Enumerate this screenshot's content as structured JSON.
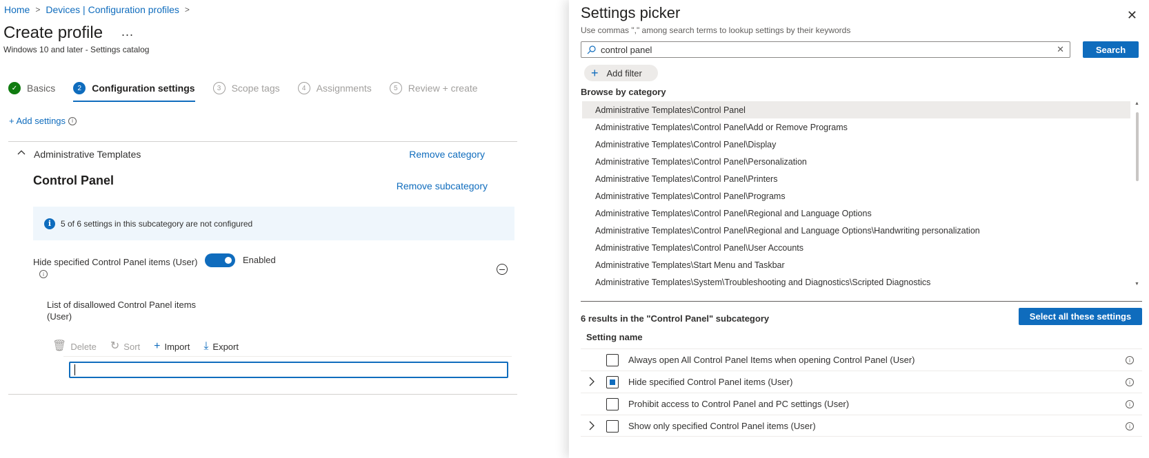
{
  "breadcrumb": {
    "home": "Home",
    "profiles": "Devices | Configuration profiles",
    "sep": ">"
  },
  "page": {
    "title": "Create profile",
    "more": "...",
    "subtitle": "Windows 10 and later - Settings catalog"
  },
  "steps": [
    {
      "num": "✓",
      "label": "Basics"
    },
    {
      "num": "2",
      "label": "Configuration settings"
    },
    {
      "num": "3",
      "label": "Scope tags"
    },
    {
      "num": "4",
      "label": "Assignments"
    },
    {
      "num": "5",
      "label": "Review + create"
    }
  ],
  "add_settings": "+ Add settings",
  "category": {
    "name": "Administrative Templates",
    "remove_category": "Remove category",
    "subcategory": "Control Panel",
    "remove_subcategory": "Remove subcategory",
    "info": "5 of 6 settings in this subcategory are not configured",
    "setting_label": "Hide specified Control Panel items (User)",
    "toggle_state": "Enabled",
    "list_label": "List of disallowed Control Panel items (User)",
    "toolbar": {
      "delete": "Delete",
      "sort": "Sort",
      "import": "Import",
      "export": "Export"
    },
    "input_value": ""
  },
  "picker": {
    "title": "Settings picker",
    "help": "Use commas \",\" among search terms to lookup settings by their keywords",
    "search_value": "control panel",
    "search_button": "Search",
    "add_filter": "Add filter",
    "browse_title": "Browse by category",
    "categories": [
      "Administrative Templates\\Control Panel",
      "Administrative Templates\\Control Panel\\Add or Remove Programs",
      "Administrative Templates\\Control Panel\\Display",
      "Administrative Templates\\Control Panel\\Personalization",
      "Administrative Templates\\Control Panel\\Printers",
      "Administrative Templates\\Control Panel\\Programs",
      "Administrative Templates\\Control Panel\\Regional and Language Options",
      "Administrative Templates\\Control Panel\\Regional and Language Options\\Handwriting personalization",
      "Administrative Templates\\Control Panel\\User Accounts",
      "Administrative Templates\\Start Menu and Taskbar",
      "Administrative Templates\\System\\Troubleshooting and Diagnostics\\Scripted Diagnostics"
    ],
    "results_label": "6 results in the \"Control Panel\" subcategory",
    "select_all": "Select all these settings",
    "column": "Setting name",
    "results": [
      {
        "name": "Always open All Control Panel Items when opening Control Panel (User)",
        "checked": false,
        "expandable": false
      },
      {
        "name": "Hide specified Control Panel items (User)",
        "checked": true,
        "expandable": true
      },
      {
        "name": "Prohibit access to Control Panel and PC settings (User)",
        "checked": false,
        "expandable": false
      },
      {
        "name": "Show only specified Control Panel items (User)",
        "checked": false,
        "expandable": true
      }
    ]
  },
  "colors": {
    "accent": "#0f6cbd",
    "success": "#107c10",
    "info_bg": "#eff6fc"
  }
}
